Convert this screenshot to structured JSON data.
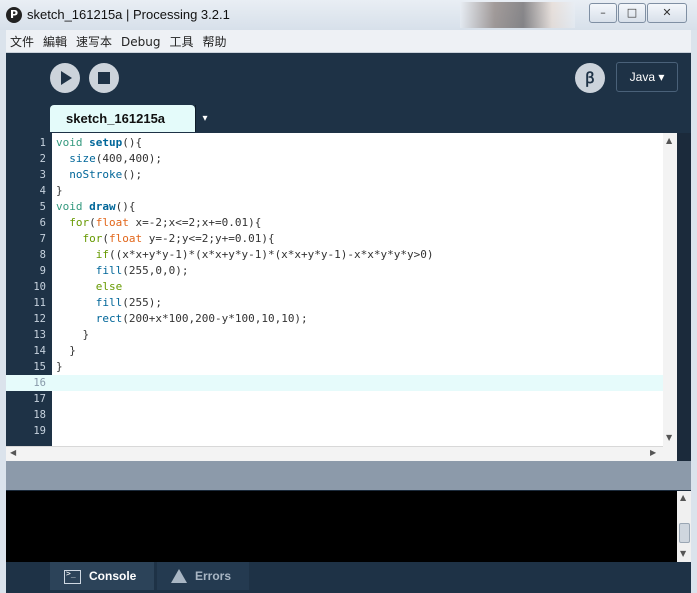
{
  "window": {
    "title": "sketch_161215a | Processing 3.2.1",
    "app_icon": "processing-logo-icon",
    "controls": {
      "minimize": "–",
      "maximize": "□",
      "close": "✕"
    }
  },
  "menu": {
    "items": [
      "文件",
      "編輯",
      "速写本",
      "Debug",
      "工具",
      "帮助"
    ]
  },
  "toolbar": {
    "run_icon": "play-icon",
    "stop_icon": "stop-icon",
    "debug_icon": "debug-icon",
    "debug_glyph": "ꞵ",
    "mode_label": "Java ▾"
  },
  "tab": {
    "name": "sketch_161215a",
    "menu_arrow": "▾"
  },
  "editor": {
    "current_line": 16,
    "lines": [
      "void setup(){",
      "  size(400,400);",
      "  noStroke();",
      "}",
      "void draw(){",
      "  for(float x=-2;x<=2;x+=0.01){",
      "    for(float y=-2;y<=2;y+=0.01){",
      "      if((x*x+y*y-1)*(x*x+y*y-1)*(x*x+y*y-1)-x*x*y*y*y>0)",
      "      fill(255,0,0);",
      "      else",
      "      fill(255);",
      "      rect(200+x*100,200-y*100,10,10);",
      "    }",
      "  }",
      "}",
      "",
      "",
      "",
      ""
    ],
    "line_numbers": [
      "1",
      "2",
      "3",
      "4",
      "5",
      "6",
      "7",
      "8",
      "9",
      "10",
      "11",
      "12",
      "13",
      "14",
      "15",
      "16",
      "17",
      "18",
      "19"
    ]
  },
  "scroll": {
    "up": "▲",
    "down": "▼",
    "left": "◀",
    "right": "▶"
  },
  "footer": {
    "console_label": "Console",
    "errors_label": "Errors"
  },
  "colors": {
    "keyword": "#33997e",
    "function_def": "#006699",
    "type": "#e2661a",
    "control": "#669900",
    "background_dark": "#1e3246"
  }
}
